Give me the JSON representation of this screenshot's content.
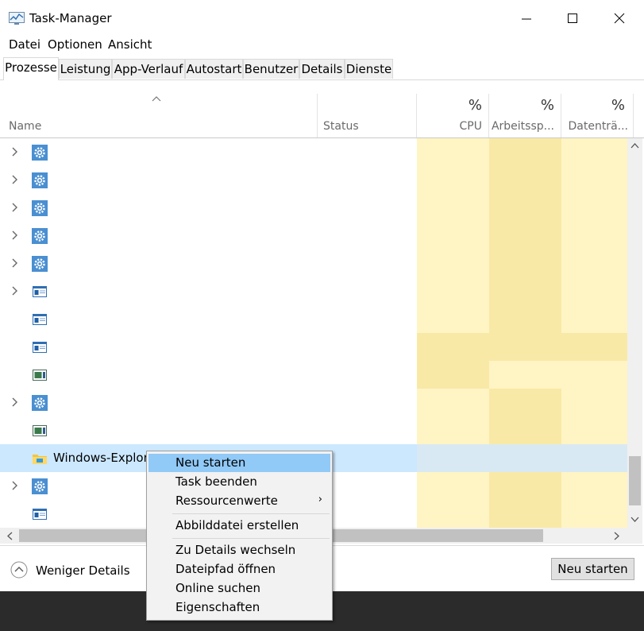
{
  "window": {
    "title": "Task-Manager"
  },
  "menubar": {
    "items": [
      "Datei",
      "Optionen",
      "Ansicht"
    ]
  },
  "tabs": [
    "Prozesse",
    "Leistung",
    "App-Verlauf",
    "Autostart",
    "Benutzer",
    "Details",
    "Dienste"
  ],
  "columns": {
    "name": "Name",
    "status": "Status",
    "cpu": {
      "percent": "%",
      "label": "CPU"
    },
    "memory": {
      "percent": "%",
      "label": "Arbeitssp..."
    },
    "disk": {
      "percent": "%",
      "label": "Datenträ..."
    }
  },
  "rows": [
    {
      "icon": "gear-icon",
      "expandable": true,
      "name": ""
    },
    {
      "icon": "gear-icon",
      "expandable": true,
      "name": ""
    },
    {
      "icon": "gear-icon",
      "expandable": true,
      "name": ""
    },
    {
      "icon": "gear-icon",
      "expandable": true,
      "name": ""
    },
    {
      "icon": "gear-icon",
      "expandable": true,
      "name": ""
    },
    {
      "icon": "app-window-icon",
      "expandable": true,
      "name": ""
    },
    {
      "icon": "app-window-icon",
      "expandable": false,
      "name": ""
    },
    {
      "icon": "app-window-icon",
      "expandable": false,
      "name": ""
    },
    {
      "icon": "app-window-green-icon",
      "expandable": false,
      "name": ""
    },
    {
      "icon": "gear-icon",
      "expandable": true,
      "name": ""
    },
    {
      "icon": "app-window-green-icon",
      "expandable": false,
      "name": ""
    },
    {
      "icon": "folder-icon",
      "expandable": false,
      "name": "Windows-Explorer",
      "selected": true
    },
    {
      "icon": "gear-icon",
      "expandable": true,
      "name": ""
    },
    {
      "icon": "app-window-icon",
      "expandable": false,
      "name": ""
    }
  ],
  "context_menu": {
    "items": [
      {
        "label": "Neu starten",
        "highlighted": true
      },
      {
        "label": "Task beenden"
      },
      {
        "label": "Ressourcenwerte",
        "submenu": true
      },
      {
        "separator": true
      },
      {
        "label": "Abbilddatei erstellen"
      },
      {
        "separator": true
      },
      {
        "label": "Zu Details wechseln"
      },
      {
        "label": "Dateipfad öffnen"
      },
      {
        "label": "Online suchen"
      },
      {
        "label": "Eigenschaften"
      }
    ]
  },
  "footer": {
    "less_details": "Weniger Details",
    "action_button": "Neu starten"
  },
  "colors": {
    "cpu_column": "#fff4c4",
    "memory_column": "#f9e9a6",
    "selection": "#cce8ff",
    "menu_highlight": "#91c9f7",
    "taskbar": "#2b2b2b"
  }
}
